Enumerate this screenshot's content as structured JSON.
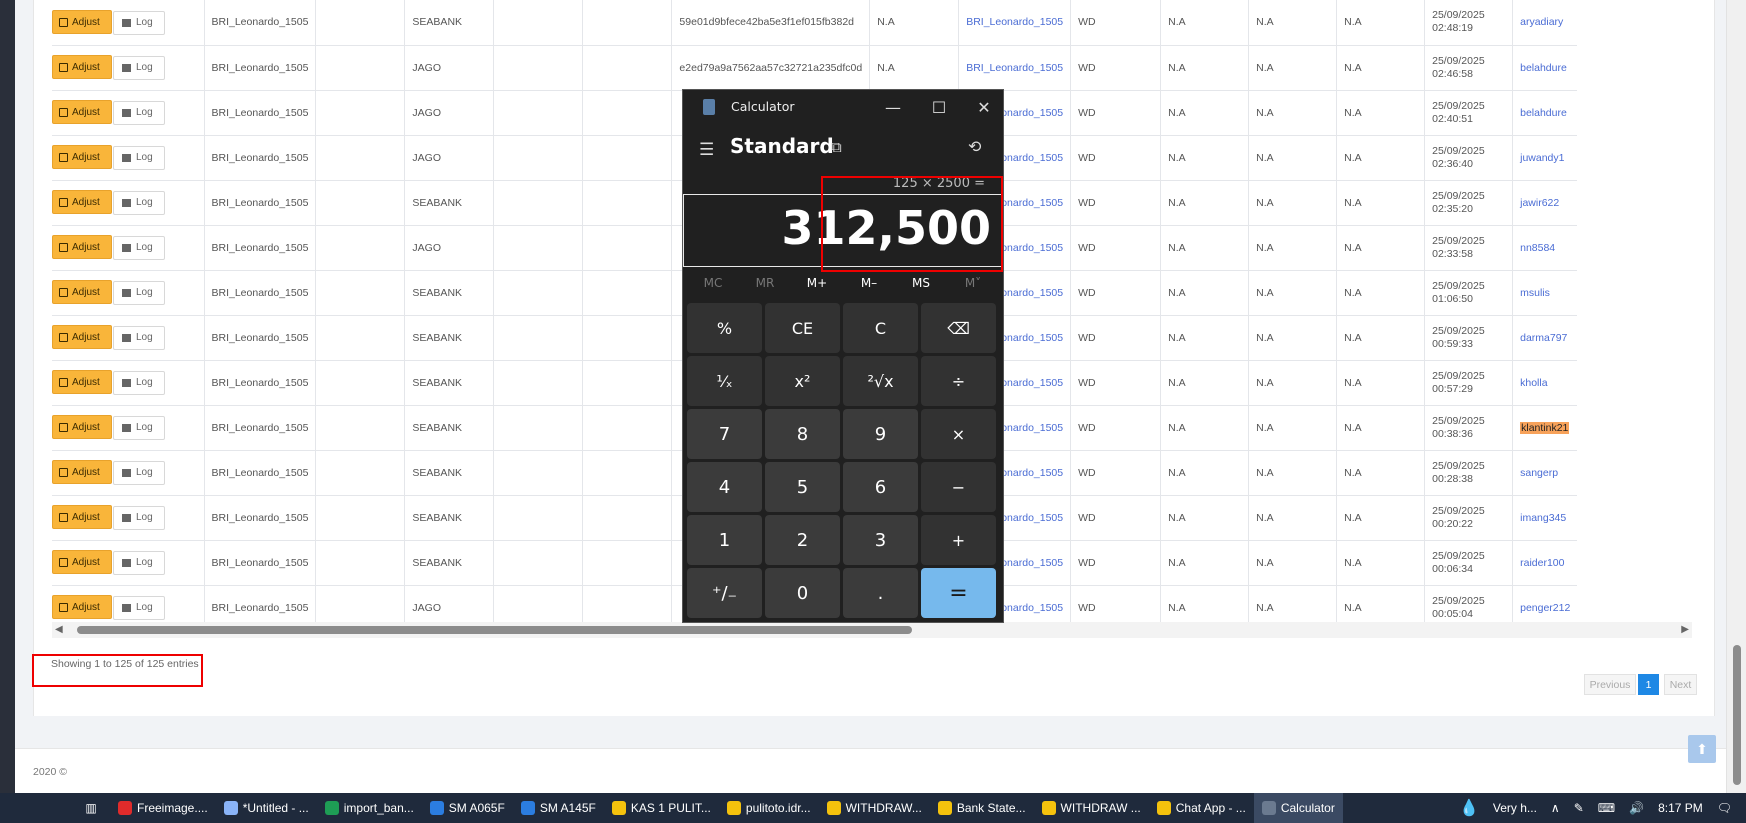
{
  "table": {
    "rows": [
      {
        "adjust": "Adjust",
        "log": "Log",
        "account": "BRI_Leonardo_1505",
        "bank": "SEABANK",
        "hash": "59e01d9bfece42ba5e3f1ef015fb382d",
        "na1": "N.A",
        "link": "BRI_Leonardo_1505",
        "type": "WD",
        "na2": "N.A",
        "na3": "N.A",
        "na4": "N.A",
        "date": "25/09/2025",
        "time": "02:48:19",
        "user": "aryadiary"
      },
      {
        "adjust": "Adjust",
        "log": "Log",
        "account": "BRI_Leonardo_1505",
        "bank": "JAGO",
        "hash": "e2ed79a9a7562aa57c32721a235dfc0d",
        "na1": "N.A",
        "link": "BRI_Leonardo_1505",
        "type": "WD",
        "na2": "N.A",
        "na3": "N.A",
        "na4": "N.A",
        "date": "25/09/2025",
        "time": "02:46:58",
        "user": "belahdure"
      },
      {
        "adjust": "Adjust",
        "log": "Log",
        "account": "BRI_Leonardo_1505",
        "bank": "JAGO",
        "hash": "",
        "na1": "",
        "link": "BRI_Leonardo_1505",
        "type": "WD",
        "na2": "N.A",
        "na3": "N.A",
        "na4": "N.A",
        "date": "25/09/2025",
        "time": "02:40:51",
        "user": "belahdure"
      },
      {
        "adjust": "Adjust",
        "log": "Log",
        "account": "BRI_Leonardo_1505",
        "bank": "JAGO",
        "hash": "",
        "na1": "",
        "link": "BRI_Leonardo_1505",
        "type": "WD",
        "na2": "N.A",
        "na3": "N.A",
        "na4": "N.A",
        "date": "25/09/2025",
        "time": "02:36:40",
        "user": "juwandy1"
      },
      {
        "adjust": "Adjust",
        "log": "Log",
        "account": "BRI_Leonardo_1505",
        "bank": "SEABANK",
        "hash": "",
        "na1": "",
        "link": "BRI_Leonardo_1505",
        "type": "WD",
        "na2": "N.A",
        "na3": "N.A",
        "na4": "N.A",
        "date": "25/09/2025",
        "time": "02:35:20",
        "user": "jawir622"
      },
      {
        "adjust": "Adjust",
        "log": "Log",
        "account": "BRI_Leonardo_1505",
        "bank": "JAGO",
        "hash": "",
        "na1": "",
        "link": "BRI_Leonardo_1505",
        "type": "WD",
        "na2": "N.A",
        "na3": "N.A",
        "na4": "N.A",
        "date": "25/09/2025",
        "time": "02:33:58",
        "user": "nn8584"
      },
      {
        "adjust": "Adjust",
        "log": "Log",
        "account": "BRI_Leonardo_1505",
        "bank": "SEABANK",
        "hash": "",
        "na1": "",
        "link": "BRI_Leonardo_1505",
        "type": "WD",
        "na2": "N.A",
        "na3": "N.A",
        "na4": "N.A",
        "date": "25/09/2025",
        "time": "01:06:50",
        "user": "msulis"
      },
      {
        "adjust": "Adjust",
        "log": "Log",
        "account": "BRI_Leonardo_1505",
        "bank": "SEABANK",
        "hash": "",
        "na1": "",
        "link": "BRI_Leonardo_1505",
        "type": "WD",
        "na2": "N.A",
        "na3": "N.A",
        "na4": "N.A",
        "date": "25/09/2025",
        "time": "00:59:33",
        "user": "darma797"
      },
      {
        "adjust": "Adjust",
        "log": "Log",
        "account": "BRI_Leonardo_1505",
        "bank": "SEABANK",
        "hash": "",
        "na1": "",
        "link": "BRI_Leonardo_1505",
        "type": "WD",
        "na2": "N.A",
        "na3": "N.A",
        "na4": "N.A",
        "date": "25/09/2025",
        "time": "00:57:29",
        "user": "kholla"
      },
      {
        "adjust": "Adjust",
        "log": "Log",
        "account": "BRI_Leonardo_1505",
        "bank": "SEABANK",
        "hash": "",
        "na1": "",
        "link": "BRI_Leonardo_1505",
        "type": "WD",
        "na2": "N.A",
        "na3": "N.A",
        "na4": "N.A",
        "date": "25/09/2025",
        "time": "00:38:36",
        "user": "klantink21",
        "highlight": true
      },
      {
        "adjust": "Adjust",
        "log": "Log",
        "account": "BRI_Leonardo_1505",
        "bank": "SEABANK",
        "hash": "",
        "na1": "",
        "link": "BRI_Leonardo_1505",
        "type": "WD",
        "na2": "N.A",
        "na3": "N.A",
        "na4": "N.A",
        "date": "25/09/2025",
        "time": "00:28:38",
        "user": "sangerp"
      },
      {
        "adjust": "Adjust",
        "log": "Log",
        "account": "BRI_Leonardo_1505",
        "bank": "SEABANK",
        "hash": "",
        "na1": "",
        "link": "BRI_Leonardo_1505",
        "type": "WD",
        "na2": "N.A",
        "na3": "N.A",
        "na4": "N.A",
        "date": "25/09/2025",
        "time": "00:20:22",
        "user": "imang345"
      },
      {
        "adjust": "Adjust",
        "log": "Log",
        "account": "BRI_Leonardo_1505",
        "bank": "SEABANK",
        "hash": "",
        "na1": "",
        "link": "BRI_Leonardo_1505",
        "type": "WD",
        "na2": "N.A",
        "na3": "N.A",
        "na4": "N.A",
        "date": "25/09/2025",
        "time": "00:06:34",
        "user": "raider100"
      },
      {
        "adjust": "Adjust",
        "log": "Log",
        "account": "BRI_Leonardo_1505",
        "bank": "JAGO",
        "hash": "",
        "na1": "",
        "link": "BRI_Leonardo_1505",
        "type": "WD",
        "na2": "N.A",
        "na3": "N.A",
        "na4": "N.A",
        "date": "25/09/2025",
        "time": "00:05:04",
        "user": "penger212"
      }
    ]
  },
  "pagination": {
    "showing": "Showing 1 to 125 of 125 entries",
    "previous": "Previous",
    "current": "1",
    "next": "Next"
  },
  "footer": {
    "copyright": "2020 ©"
  },
  "calculator": {
    "title": "Calculator",
    "mode": "Standard",
    "expression": "125 × 2500 =",
    "result": "312,500",
    "memory": [
      "MC",
      "MR",
      "M+",
      "M–",
      "MS",
      "M˅"
    ],
    "keys": [
      "%",
      "CE",
      "C",
      "⌫",
      "¹⁄ₓ",
      "x²",
      "²√x",
      "÷",
      "7",
      "8",
      "9",
      "×",
      "4",
      "5",
      "6",
      "−",
      "1",
      "2",
      "3",
      "+",
      "⁺/₋",
      "0",
      ".",
      "="
    ]
  },
  "taskbar": {
    "items": [
      "Freeimage....",
      "*Untitled - ...",
      "import_ban...",
      "SM A065F",
      "SM A145F",
      "KAS 1 PULIT...",
      "pulitoto.idr...",
      "WITHDRAW...",
      "Bank State...",
      "WITHDRAW ...",
      "Chat App - ...",
      "Calculator"
    ],
    "weather": "Very h...",
    "time": "8:17 PM"
  },
  "colors": {
    "accent": "#f9b53a",
    "link": "#4a6cd4",
    "calc_equals": "#76b9ed",
    "highlight_box": "#e00000"
  }
}
